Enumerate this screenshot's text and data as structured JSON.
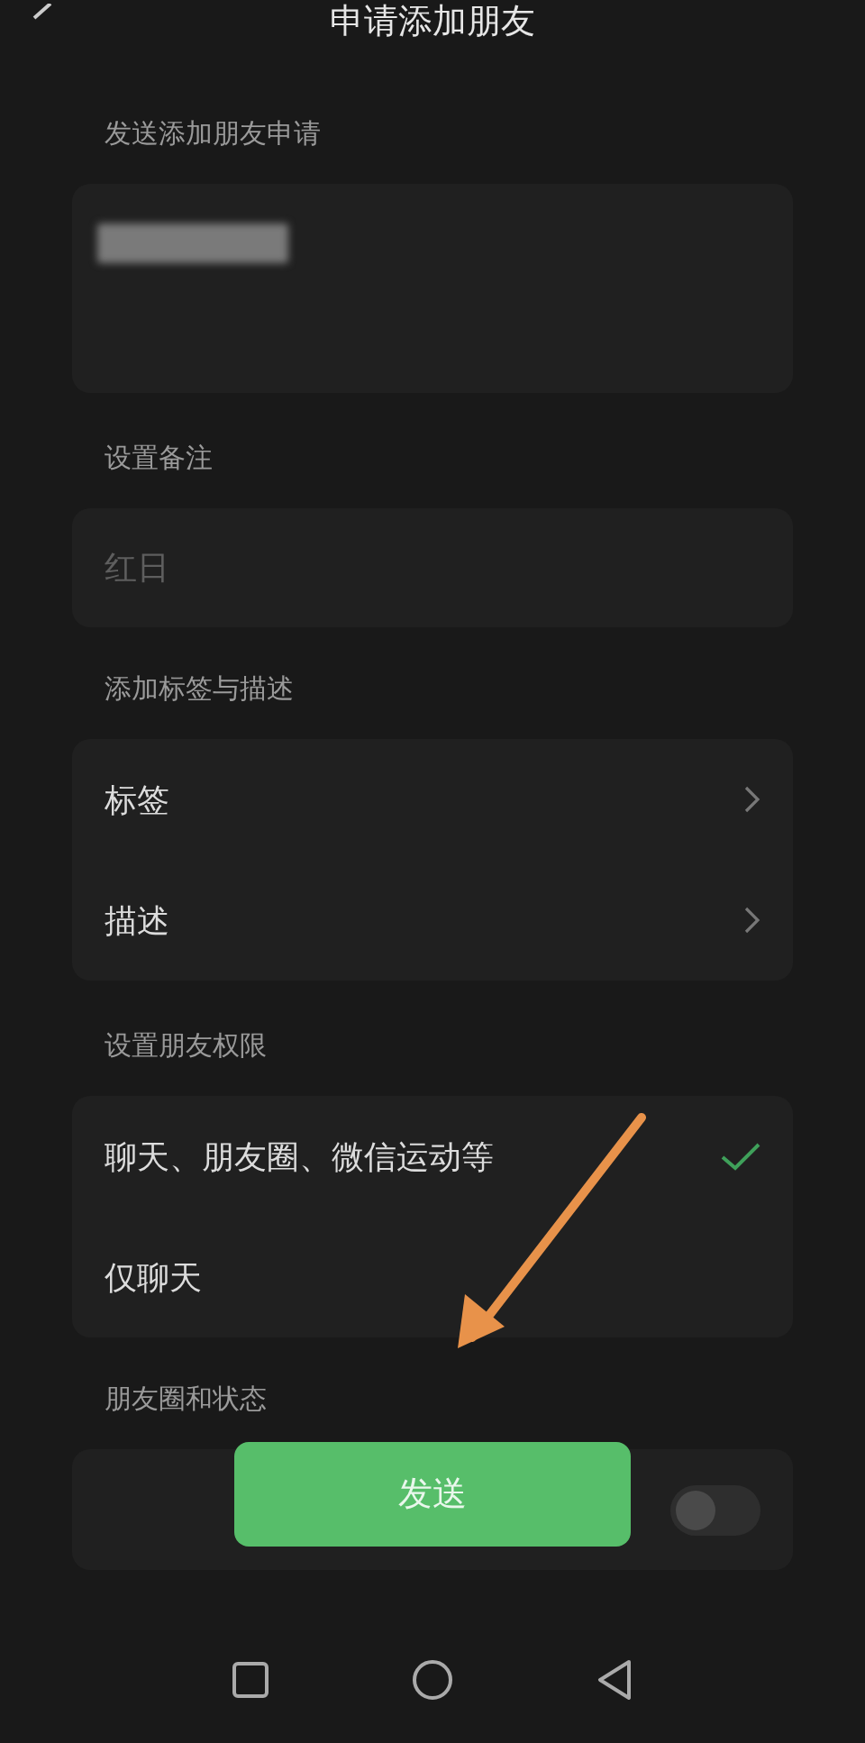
{
  "header": {
    "title": "申请添加朋友"
  },
  "request_section": {
    "label": "发送添加朋友申请"
  },
  "remark_section": {
    "label": "设置备注",
    "placeholder": "红日"
  },
  "tags_section": {
    "label": "添加标签与描述",
    "items": [
      {
        "label": "标签"
      },
      {
        "label": "描述"
      }
    ]
  },
  "permission_section": {
    "label": "设置朋友权限",
    "options": [
      {
        "label": "聊天、朋友圈、微信运动等",
        "selected": true
      },
      {
        "label": "仅聊天",
        "selected": false
      }
    ]
  },
  "moments_section": {
    "label": "朋友圈和状态",
    "toggle_on": false
  },
  "send_button": {
    "label": "发送"
  }
}
